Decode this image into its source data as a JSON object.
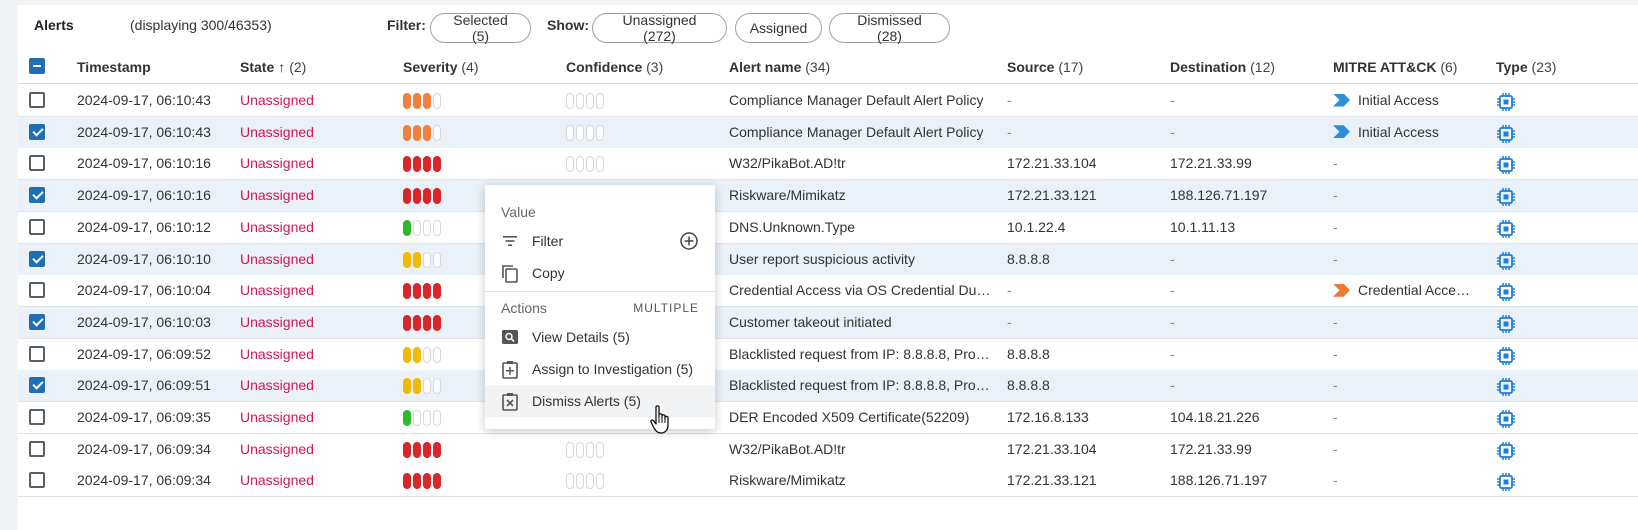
{
  "topbar": {
    "title": "Alerts",
    "displaying": "(displaying 300/46353)",
    "filter_label": "Filter:",
    "filter_selected": "Selected (5)",
    "show_label": "Show:",
    "show_unassigned": "Unassigned (272)",
    "show_assigned": "Assigned",
    "show_dismissed": "Dismissed (28)"
  },
  "columns": {
    "timestamp": "Timestamp",
    "state": "State",
    "state_count": "(2)",
    "severity": "Severity",
    "severity_count": "(4)",
    "confidence": "Confidence",
    "confidence_count": "(3)",
    "alert_name": "Alert name",
    "alert_name_count": "(34)",
    "source": "Source",
    "source_count": "(17)",
    "destination": "Destination",
    "destination_count": "(12)",
    "mitre": "MITRE ATT&CK",
    "mitre_count": "(6)",
    "type": "Type",
    "type_count": "(23)"
  },
  "rows": [
    {
      "timestamp": "2024-09-17, 06:10:43",
      "state": "Unassigned",
      "severity_level": 3,
      "alert_name": "Compliance Manager Default Alert Policy",
      "source": "-",
      "destination": "-",
      "mitre": "Initial Access",
      "mitre_color": "#2a8fd8",
      "selected": false
    },
    {
      "timestamp": "2024-09-17, 06:10:43",
      "state": "Unassigned",
      "severity_level": 3,
      "alert_name": "Compliance Manager Default Alert Policy",
      "source": "-",
      "destination": "-",
      "mitre": "Initial Access",
      "mitre_color": "#2a8fd8",
      "selected": true
    },
    {
      "timestamp": "2024-09-17, 06:10:16",
      "state": "Unassigned",
      "severity_level": 4,
      "alert_name": "W32/PikaBot.AD!tr",
      "source": "172.21.33.104",
      "destination": "172.21.33.99",
      "mitre": "-",
      "selected": false
    },
    {
      "timestamp": "2024-09-17, 06:10:16",
      "state": "Unassigned",
      "severity_level": 4,
      "alert_name": "Riskware/Mimikatz",
      "source": "172.21.33.121",
      "destination": "188.126.71.197",
      "mitre": "-",
      "selected": true
    },
    {
      "timestamp": "2024-09-17, 06:10:12",
      "state": "Unassigned",
      "severity_level": 1,
      "alert_name": "DNS.Unknown.Type",
      "source": "10.1.22.4",
      "destination": "10.1.11.13",
      "mitre": "-",
      "selected": false
    },
    {
      "timestamp": "2024-09-17, 06:10:10",
      "state": "Unassigned",
      "severity_level": 2,
      "alert_name": "User report suspicious activity",
      "source": "8.8.8.8",
      "destination": "-",
      "mitre": "-",
      "selected": true
    },
    {
      "timestamp": "2024-09-17, 06:10:04",
      "state": "Unassigned",
      "severity_level": 4,
      "alert_name": "Credential Access via OS Credential Dum…",
      "source": "-",
      "destination": "-",
      "mitre": "Credential Acce…",
      "mitre_color": "#f07a32",
      "selected": false
    },
    {
      "timestamp": "2024-09-17, 06:10:03",
      "state": "Unassigned",
      "severity_level": 4,
      "alert_name": "Customer takeout initiated",
      "source": "-",
      "destination": "-",
      "mitre": "-",
      "selected": true
    },
    {
      "timestamp": "2024-09-17, 06:09:52",
      "state": "Unassigned",
      "severity_level": 2,
      "alert_name": "Blacklisted request from IP: 8.8.8.8, Prox…",
      "source": "8.8.8.8",
      "destination": "-",
      "mitre": "-",
      "selected": false
    },
    {
      "timestamp": "2024-09-17, 06:09:51",
      "state": "Unassigned",
      "severity_level": 2,
      "alert_name": "Blacklisted request from IP: 8.8.8.8, Prox…",
      "source": "8.8.8.8",
      "destination": "-",
      "mitre": "-",
      "selected": true
    },
    {
      "timestamp": "2024-09-17, 06:09:35",
      "state": "Unassigned",
      "severity_level": 1,
      "alert_name": "DER Encoded X509 Certificate(52209)",
      "source": "172.16.8.133",
      "destination": "104.18.21.226",
      "mitre": "-",
      "selected": false
    },
    {
      "timestamp": "2024-09-17, 06:09:34",
      "state": "Unassigned",
      "severity_level": 4,
      "alert_name": "W32/PikaBot.AD!tr",
      "source": "172.21.33.104",
      "destination": "172.21.33.99",
      "mitre": "-",
      "selected": false
    },
    {
      "timestamp": "2024-09-17, 06:09:34",
      "state": "Unassigned",
      "severity_level": 4,
      "alert_name": "Riskware/Mimikatz",
      "source": "172.21.33.121",
      "destination": "188.126.71.197",
      "mitre": "-",
      "selected": false
    }
  ],
  "context_menu": {
    "value_section": "Value",
    "filter": "Filter",
    "copy": "Copy",
    "actions_section": "Actions",
    "multiple": "MULTIPLE",
    "view_details": "View Details (5)",
    "assign": "Assign to Investigation (5)",
    "dismiss": "Dismiss Alerts (5)"
  },
  "colors": {
    "accent": "#1f6fb5",
    "state_unassigned": "#d4145a",
    "severity_high": "#d8262a",
    "severity_medium_high": "#f0803c",
    "severity_medium": "#f5b800",
    "severity_low": "#2eb82e",
    "type_icon": "#1f7fd8"
  }
}
